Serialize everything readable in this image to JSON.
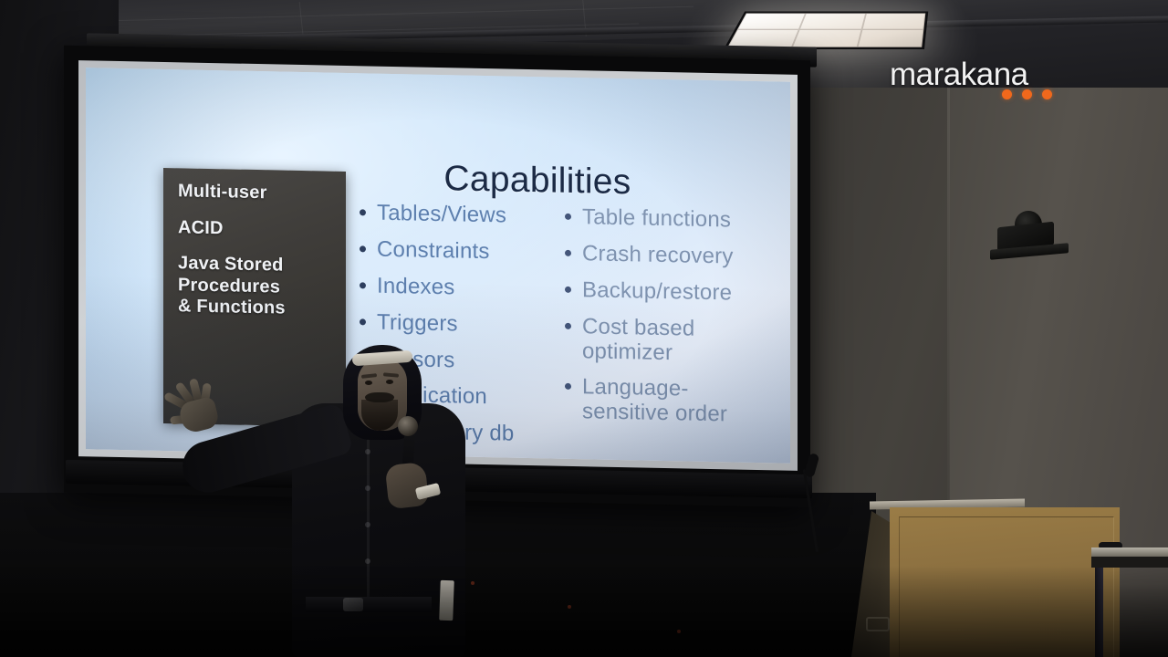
{
  "scene": {
    "type": "conference-talk-video-frame",
    "description": "Speaker presenting a slide titled Capabilities on a projection screen in a dark lecture room"
  },
  "branding": {
    "logo_text": "marakana",
    "logo_dot_count": 3,
    "logo_dot_color": "#f0681c",
    "logo_text_color": "#f2f2f2"
  },
  "slide": {
    "title": "Capabilities",
    "title_color": "#1b2a45",
    "background_color": "#bedcf7",
    "bullet_color_left": "#5d7fae",
    "bullet_color_right": "#7f93b0",
    "columns": [
      {
        "name": "left-column",
        "items": [
          "Tables/Views",
          "Constraints",
          "Indexes",
          "Triggers",
          "Cursors",
          "Replication",
          "In-memory db"
        ]
      },
      {
        "name": "right-column",
        "items": [
          "Table functions",
          "Crash recovery",
          "Backup/restore",
          "Cost based optimizer",
          "Language-sensitive order"
        ]
      }
    ],
    "callout": {
      "background_color": "#3f3d3a",
      "text_color": "#f0f2f5",
      "lines": [
        "Multi-user",
        "ACID",
        "Java Stored",
        "Procedures",
        "& Functions"
      ]
    }
  },
  "room": {
    "wall_color": "#45423d",
    "ceiling_color": "#232327",
    "light_fixture": "ceiling-light-panel",
    "wall_camera": "wall-mounted-camera",
    "podium": "wooden-lectern",
    "podium_color": "#8c7040",
    "microphone": "gooseneck-microphone",
    "side_table": "side-table"
  },
  "presenter": {
    "attire": "dark-shirt",
    "accessory_head": "white-headband",
    "holding": "handheld-microphone",
    "gesture": "left-arm-extended-open-hand",
    "badge": "lanyard-badge"
  }
}
